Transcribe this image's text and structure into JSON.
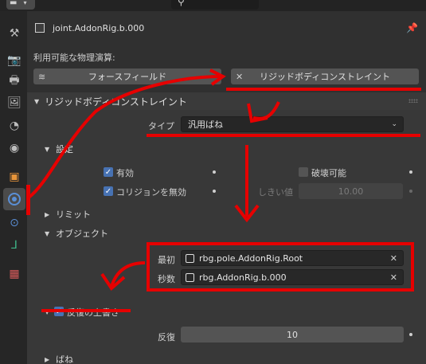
{
  "topbar": {
    "editor_type_icon": "properties-editor-icon",
    "search_icon": "search-icon"
  },
  "sidebar": {
    "tabs": [
      {
        "name": "tool",
        "icon": "tool-icon",
        "glyph": "⚒"
      },
      {
        "name": "render",
        "icon": "render-icon",
        "glyph": "📷"
      },
      {
        "name": "output",
        "icon": "output-icon",
        "glyph": "🖶"
      },
      {
        "name": "view-layer",
        "icon": "view-layer-icon",
        "glyph": "🖼"
      },
      {
        "name": "scene",
        "icon": "scene-icon",
        "glyph": "◔"
      },
      {
        "name": "world",
        "icon": "world-icon",
        "glyph": "◉"
      },
      {
        "name": "object",
        "icon": "object-icon",
        "glyph": "▣"
      },
      {
        "name": "physics",
        "icon": "physics-icon",
        "glyph": ""
      },
      {
        "name": "constraints",
        "icon": "constraint-icon",
        "glyph": "⊙"
      },
      {
        "name": "data",
        "icon": "data-icon",
        "glyph": "⅃"
      },
      {
        "name": "texture",
        "icon": "texture-icon",
        "glyph": "▦"
      }
    ]
  },
  "header": {
    "object_name": "joint.AddonRig.b.000"
  },
  "physics": {
    "available_label": "利用可能な物理演算:",
    "force_field_button": "フォースフィールド",
    "rigid_body_constraint_button": "リジッドボディコンストレイント"
  },
  "rbc_panel": {
    "title": "リジッドボディコンストレイント",
    "type_label": "タイプ",
    "type_value": "汎用ばね",
    "settings": {
      "title": "設定",
      "enabled_label": "有効",
      "disable_collisions_label": "コリジョンを無効",
      "breakable_label": "破壊可能",
      "threshold_label": "しきい値",
      "threshold_value": "10.00"
    },
    "limits": {
      "title": "リミット"
    },
    "objects": {
      "title": "オブジェクト",
      "first_label": "最初",
      "first_value": "rbg.pole.AddonRig.Root",
      "second_label": "秒数",
      "second_value": "rbg.AddonRig.b.000"
    },
    "override_iterations": {
      "title": "反復の上書き",
      "iterations_label": "反復",
      "iterations_value": "10"
    },
    "springs": {
      "title": "ばね"
    }
  },
  "colors": {
    "accent": "#4772b3",
    "annotation": "#e60000",
    "background": "#303030"
  }
}
